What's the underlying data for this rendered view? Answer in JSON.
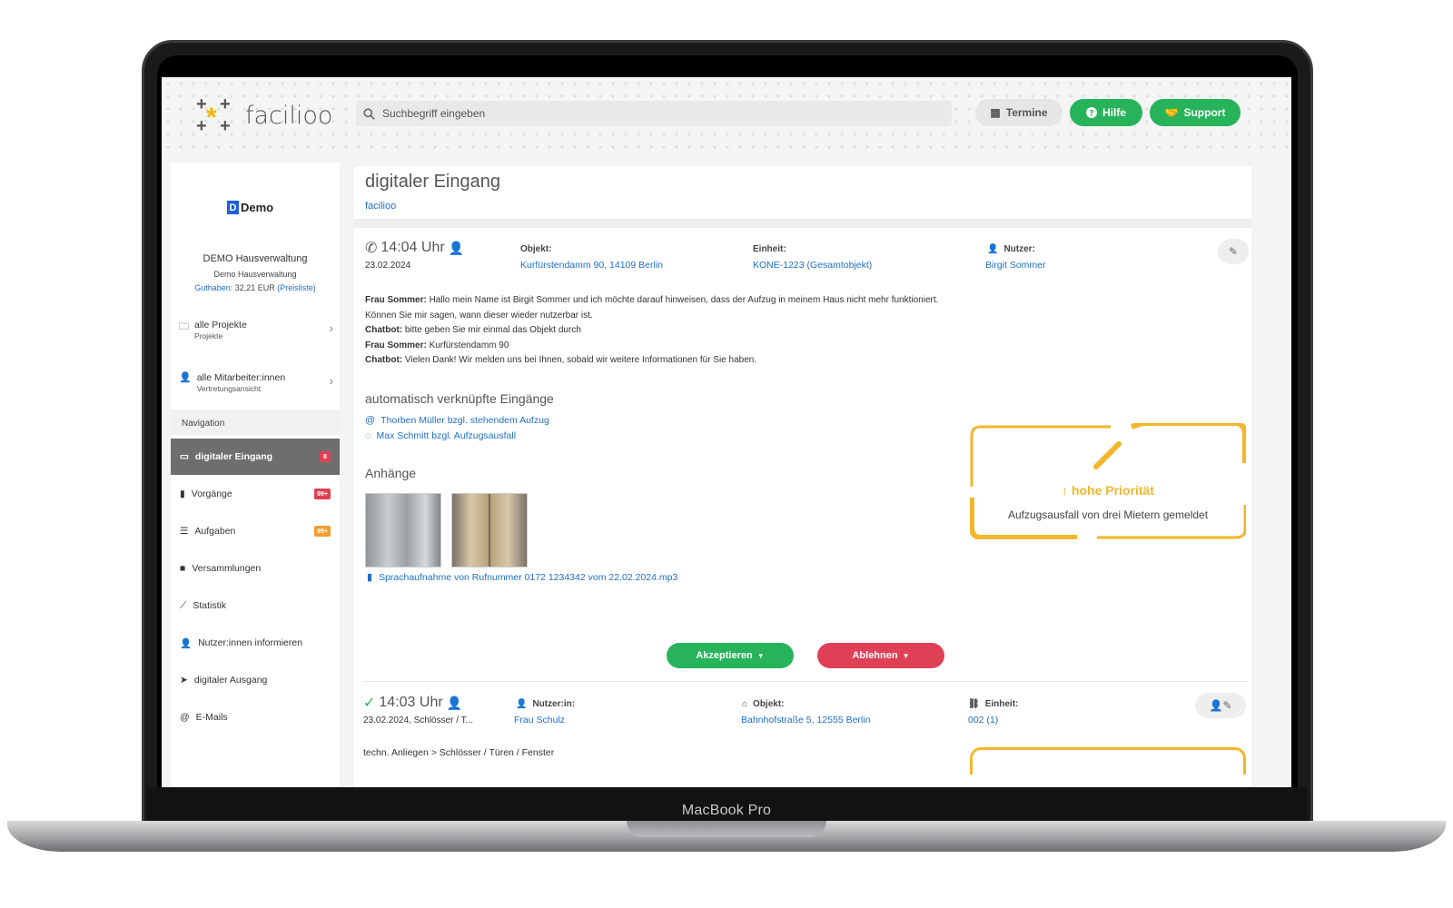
{
  "device_label": "MacBook Pro",
  "header": {
    "logo_text": "facilioo",
    "search_placeholder": "Suchbegriff eingeben",
    "termine_label": "Termine",
    "hilfe_label": "Hilfe",
    "support_label": "Support"
  },
  "sidebar": {
    "logo_text": "Demo",
    "org_name": "DEMO Hausverwaltung",
    "org_sub": "Demo Hausverwaltung",
    "guthaben_label": "Guthaben:",
    "guthaben_value": "32,21 EUR",
    "preisliste": "(Preisliste)",
    "projects": {
      "label": "alle Projekte",
      "sub": "Projekte"
    },
    "employees": {
      "label": "alle Mitarbeiter:innen",
      "sub": "Vertretungsansicht"
    },
    "nav_header": "Navigation",
    "nav": [
      {
        "label": "digitaler Eingang",
        "badge": "8"
      },
      {
        "label": "Vorgänge",
        "badge": "99+"
      },
      {
        "label": "Aufgaben",
        "badge": "99+"
      },
      {
        "label": "Versammlungen"
      },
      {
        "label": "Statistik"
      },
      {
        "label": "Nutzer:innen informieren"
      },
      {
        "label": "digitaler Ausgang"
      },
      {
        "label": "E-Mails"
      }
    ],
    "colors": {
      "badge_red": "#e04055",
      "badge_orange": "#f0a030"
    }
  },
  "main": {
    "title": "digitaler Eingang",
    "breadcrumb": "facilioo",
    "entry1": {
      "time": "14:04 Uhr",
      "date": "23.02.2024",
      "objekt_label": "Objekt:",
      "objekt_value": "Kurfürstendamm 90, 14109 Berlin",
      "einheit_label": "Einheit:",
      "einheit_value": "KONE-1223 (Gesamtobjekt)",
      "nutzer_label": "Nutzer:",
      "nutzer_value": "Birgit Sommer",
      "messages": [
        {
          "speaker": "Frau Sommer:",
          "text": " Hallo mein Name ist Birgit Sommer und ich möchte darauf hinweisen, dass der Aufzug in meinem Haus nicht mehr funktioniert."
        },
        {
          "speaker": "",
          "text": "Können Sie mir sagen, wann dieser wieder nutzerbar ist."
        },
        {
          "speaker": "Chatbot:",
          "text": " bitte geben Sie mir einmal das Objekt durch"
        },
        {
          "speaker": "Frau Sommer:",
          "text": " Kurfürstendamm 90"
        },
        {
          "speaker": "Chatbot:",
          "text": " Vielen Dank! Wir melden uns bei Ihnen, sobald wir weitere Informationen für Sie haben."
        }
      ],
      "linked_title": "automatisch verknüpfte Eingänge",
      "linked": [
        "Thorben Müller bzgl. stehendem Aufzug",
        "Max Schmitt bzgl. Aufzugsausfall"
      ],
      "attachments_title": "Anhänge",
      "audio_file": "Sprachaufnahme von Rufnummer 0172 1234342 vom 22.02.2024.mp3",
      "priority_title": "hohe Priorität",
      "priority_text": "Aufzugsausfall von drei Mietern gemeldet",
      "accept_label": "Akzeptieren",
      "reject_label": "Ablehnen"
    },
    "entry2": {
      "time": "14:03 Uhr",
      "date": "23.02.2024, Schlösser / T...",
      "nutzer_label": "Nutzer:in:",
      "nutzer_value": "Frau Schulz",
      "objekt_label": "Objekt:",
      "objekt_value": "Bahnhofstraße 5, 12555 Berlin",
      "einheit_label": "Einheit:",
      "einheit_value": "002 (1)",
      "category": "techn. Anliegen > Schlösser / Türen / Fenster"
    },
    "colors": {
      "accent_green": "#26b35a",
      "accent_red": "#e04055",
      "priority_yellow": "#f2b62c",
      "link_blue": "#1f6fc6"
    }
  }
}
